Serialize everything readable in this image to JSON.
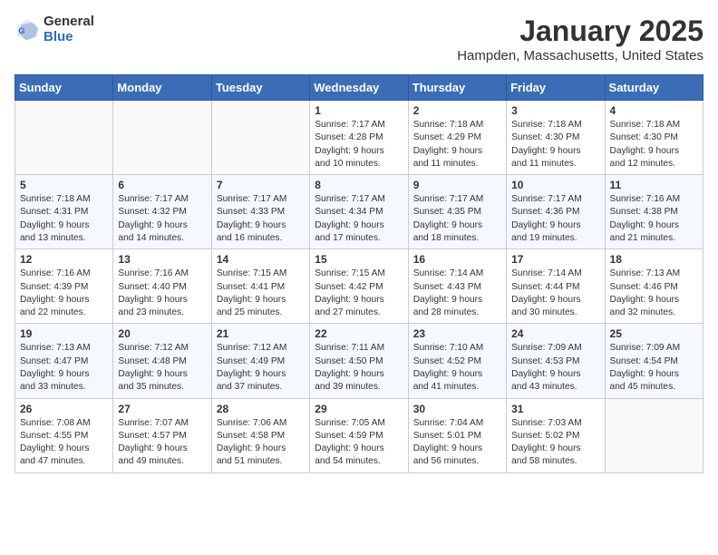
{
  "header": {
    "logo_general": "General",
    "logo_blue": "Blue",
    "title": "January 2025",
    "subtitle": "Hampden, Massachusetts, United States"
  },
  "weekdays": [
    "Sunday",
    "Monday",
    "Tuesday",
    "Wednesday",
    "Thursday",
    "Friday",
    "Saturday"
  ],
  "weeks": [
    [
      {
        "day": "",
        "info": ""
      },
      {
        "day": "",
        "info": ""
      },
      {
        "day": "",
        "info": ""
      },
      {
        "day": "1",
        "info": "Sunrise: 7:17 AM\nSunset: 4:28 PM\nDaylight: 9 hours\nand 10 minutes."
      },
      {
        "day": "2",
        "info": "Sunrise: 7:18 AM\nSunset: 4:29 PM\nDaylight: 9 hours\nand 11 minutes."
      },
      {
        "day": "3",
        "info": "Sunrise: 7:18 AM\nSunset: 4:30 PM\nDaylight: 9 hours\nand 11 minutes."
      },
      {
        "day": "4",
        "info": "Sunrise: 7:18 AM\nSunset: 4:30 PM\nDaylight: 9 hours\nand 12 minutes."
      }
    ],
    [
      {
        "day": "5",
        "info": "Sunrise: 7:18 AM\nSunset: 4:31 PM\nDaylight: 9 hours\nand 13 minutes."
      },
      {
        "day": "6",
        "info": "Sunrise: 7:17 AM\nSunset: 4:32 PM\nDaylight: 9 hours\nand 14 minutes."
      },
      {
        "day": "7",
        "info": "Sunrise: 7:17 AM\nSunset: 4:33 PM\nDaylight: 9 hours\nand 16 minutes."
      },
      {
        "day": "8",
        "info": "Sunrise: 7:17 AM\nSunset: 4:34 PM\nDaylight: 9 hours\nand 17 minutes."
      },
      {
        "day": "9",
        "info": "Sunrise: 7:17 AM\nSunset: 4:35 PM\nDaylight: 9 hours\nand 18 minutes."
      },
      {
        "day": "10",
        "info": "Sunrise: 7:17 AM\nSunset: 4:36 PM\nDaylight: 9 hours\nand 19 minutes."
      },
      {
        "day": "11",
        "info": "Sunrise: 7:16 AM\nSunset: 4:38 PM\nDaylight: 9 hours\nand 21 minutes."
      }
    ],
    [
      {
        "day": "12",
        "info": "Sunrise: 7:16 AM\nSunset: 4:39 PM\nDaylight: 9 hours\nand 22 minutes."
      },
      {
        "day": "13",
        "info": "Sunrise: 7:16 AM\nSunset: 4:40 PM\nDaylight: 9 hours\nand 23 minutes."
      },
      {
        "day": "14",
        "info": "Sunrise: 7:15 AM\nSunset: 4:41 PM\nDaylight: 9 hours\nand 25 minutes."
      },
      {
        "day": "15",
        "info": "Sunrise: 7:15 AM\nSunset: 4:42 PM\nDaylight: 9 hours\nand 27 minutes."
      },
      {
        "day": "16",
        "info": "Sunrise: 7:14 AM\nSunset: 4:43 PM\nDaylight: 9 hours\nand 28 minutes."
      },
      {
        "day": "17",
        "info": "Sunrise: 7:14 AM\nSunset: 4:44 PM\nDaylight: 9 hours\nand 30 minutes."
      },
      {
        "day": "18",
        "info": "Sunrise: 7:13 AM\nSunset: 4:46 PM\nDaylight: 9 hours\nand 32 minutes."
      }
    ],
    [
      {
        "day": "19",
        "info": "Sunrise: 7:13 AM\nSunset: 4:47 PM\nDaylight: 9 hours\nand 33 minutes."
      },
      {
        "day": "20",
        "info": "Sunrise: 7:12 AM\nSunset: 4:48 PM\nDaylight: 9 hours\nand 35 minutes."
      },
      {
        "day": "21",
        "info": "Sunrise: 7:12 AM\nSunset: 4:49 PM\nDaylight: 9 hours\nand 37 minutes."
      },
      {
        "day": "22",
        "info": "Sunrise: 7:11 AM\nSunset: 4:50 PM\nDaylight: 9 hours\nand 39 minutes."
      },
      {
        "day": "23",
        "info": "Sunrise: 7:10 AM\nSunset: 4:52 PM\nDaylight: 9 hours\nand 41 minutes."
      },
      {
        "day": "24",
        "info": "Sunrise: 7:09 AM\nSunset: 4:53 PM\nDaylight: 9 hours\nand 43 minutes."
      },
      {
        "day": "25",
        "info": "Sunrise: 7:09 AM\nSunset: 4:54 PM\nDaylight: 9 hours\nand 45 minutes."
      }
    ],
    [
      {
        "day": "26",
        "info": "Sunrise: 7:08 AM\nSunset: 4:55 PM\nDaylight: 9 hours\nand 47 minutes."
      },
      {
        "day": "27",
        "info": "Sunrise: 7:07 AM\nSunset: 4:57 PM\nDaylight: 9 hours\nand 49 minutes."
      },
      {
        "day": "28",
        "info": "Sunrise: 7:06 AM\nSunset: 4:58 PM\nDaylight: 9 hours\nand 51 minutes."
      },
      {
        "day": "29",
        "info": "Sunrise: 7:05 AM\nSunset: 4:59 PM\nDaylight: 9 hours\nand 54 minutes."
      },
      {
        "day": "30",
        "info": "Sunrise: 7:04 AM\nSunset: 5:01 PM\nDaylight: 9 hours\nand 56 minutes."
      },
      {
        "day": "31",
        "info": "Sunrise: 7:03 AM\nSunset: 5:02 PM\nDaylight: 9 hours\nand 58 minutes."
      },
      {
        "day": "",
        "info": ""
      }
    ]
  ]
}
